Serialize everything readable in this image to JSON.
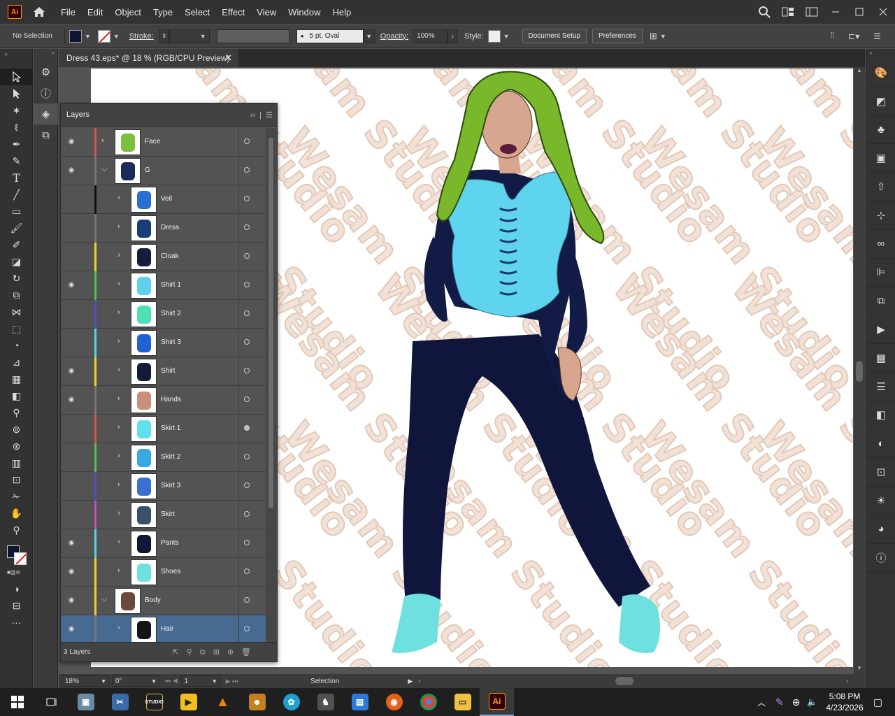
{
  "app": {
    "badge": "Ai"
  },
  "menu": [
    "File",
    "Edit",
    "Object",
    "Type",
    "Select",
    "Effect",
    "View",
    "Window",
    "Help"
  ],
  "control": {
    "selection": "No Selection",
    "stroke_label": "Stroke:",
    "brush": "5 pt. Oval",
    "opacity_label": "Opacity:",
    "opacity_value": "100%",
    "style_label": "Style:",
    "doc_setup": "Document Setup",
    "preferences": "Preferences",
    "fill_color": "#0e1533"
  },
  "document": {
    "tab_title": "Dress 43.eps* @ 18 % (RGB/CPU Preview)"
  },
  "watermark": "Wesam Studio",
  "layers_panel": {
    "title": "Layers",
    "count": "3 Layers",
    "rows": [
      {
        "name": "Face",
        "indent": 0,
        "expanded": false,
        "visible": true,
        "color": "#d9534f",
        "target": false,
        "thumb": "#7bbf3a",
        "sel": false
      },
      {
        "name": "G",
        "indent": 0,
        "expanded": true,
        "visible": true,
        "color": "#777777",
        "target": false,
        "thumb": "#1a2a5a",
        "sel": false
      },
      {
        "name": "Veil",
        "indent": 1,
        "expanded": false,
        "visible": false,
        "color": "#111111",
        "target": false,
        "thumb": "#2a6fd1",
        "sel": false
      },
      {
        "name": "Dress",
        "indent": 1,
        "expanded": false,
        "visible": false,
        "color": "#777777",
        "target": false,
        "thumb": "#1a3c77",
        "sel": false
      },
      {
        "name": "Cloak",
        "indent": 1,
        "expanded": false,
        "visible": false,
        "color": "#f0d12a",
        "target": false,
        "thumb": "#1a1a3a",
        "sel": false
      },
      {
        "name": "Shirt 1",
        "indent": 1,
        "expanded": false,
        "visible": true,
        "color": "#4fc24f",
        "target": false,
        "thumb": "#5fd0ee",
        "sel": false
      },
      {
        "name": "Shirt 2",
        "indent": 1,
        "expanded": false,
        "visible": false,
        "color": "#4f4fc2",
        "target": false,
        "thumb": "#4fe0b4",
        "sel": false
      },
      {
        "name": "Shirt 3",
        "indent": 1,
        "expanded": false,
        "visible": false,
        "color": "#4fd8e0",
        "target": false,
        "thumb": "#2060d0",
        "sel": false
      },
      {
        "name": "Shirt",
        "indent": 1,
        "expanded": false,
        "visible": true,
        "color": "#f0d12a",
        "target": false,
        "thumb": "#131a3a",
        "sel": false
      },
      {
        "name": "Hands",
        "indent": 1,
        "expanded": false,
        "visible": true,
        "color": "#777777",
        "target": false,
        "thumb": "#c89078",
        "sel": false
      },
      {
        "name": "Skirt 1",
        "indent": 1,
        "expanded": false,
        "visible": false,
        "color": "#d9534f",
        "target": true,
        "thumb": "#5fe0ea",
        "sel": false
      },
      {
        "name": "Skirt 2",
        "indent": 1,
        "expanded": false,
        "visible": false,
        "color": "#4fc24f",
        "target": false,
        "thumb": "#38a8e0",
        "sel": false
      },
      {
        "name": "Skirt 3",
        "indent": 1,
        "expanded": false,
        "visible": false,
        "color": "#4f4fc2",
        "target": false,
        "thumb": "#3a6fd0",
        "sel": false
      },
      {
        "name": "Skirt",
        "indent": 1,
        "expanded": false,
        "visible": false,
        "color": "#c24fc2",
        "target": false,
        "thumb": "#3a4f6a",
        "sel": false
      },
      {
        "name": "Pants",
        "indent": 1,
        "expanded": false,
        "visible": true,
        "color": "#4fd8e0",
        "target": false,
        "thumb": "#101838",
        "sel": false
      },
      {
        "name": "Shoes",
        "indent": 1,
        "expanded": false,
        "visible": true,
        "color": "#f0d12a",
        "target": false,
        "thumb": "#6fe0e0",
        "sel": false
      },
      {
        "name": "Body",
        "indent": 0,
        "expanded": true,
        "visible": true,
        "color": "#f0d12a",
        "target": false,
        "thumb": "#6a4a3a",
        "sel": false
      },
      {
        "name": "Hair",
        "indent": 1,
        "expanded": false,
        "visible": true,
        "color": "#777777",
        "target": false,
        "thumb": "#151515",
        "sel": true
      }
    ]
  },
  "status": {
    "zoom": "18%",
    "rotate": "0°",
    "artboard": "1",
    "mode": "Selection"
  },
  "taskbar": {
    "time": "5:08 PM",
    "date": "4/23/2026"
  }
}
